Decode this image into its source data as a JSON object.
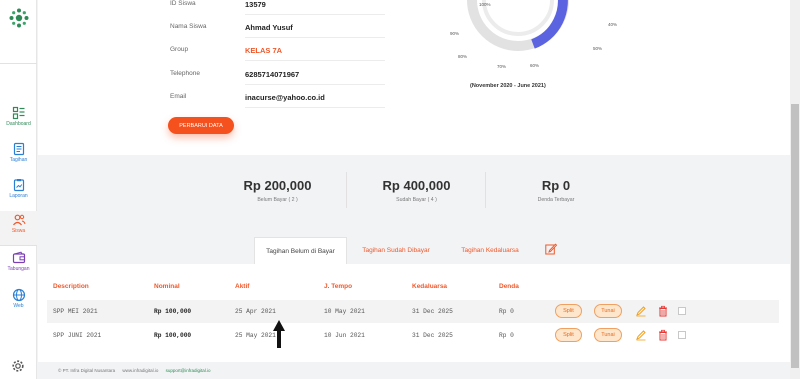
{
  "sidebar": {
    "logo_icon": "gear-cluster-logo",
    "items": [
      {
        "label": "Dashboard",
        "icon": "dashboard-icon"
      },
      {
        "label": "Tagihan",
        "icon": "bill-icon"
      },
      {
        "label": "Laporan",
        "icon": "report-icon"
      },
      {
        "label": "Siswa",
        "icon": "students-icon"
      },
      {
        "label": "Tabungan",
        "icon": "wallet-icon"
      },
      {
        "label": "Web",
        "icon": "globe-icon"
      }
    ],
    "active": "Siswa",
    "settings_icon": "settings-icon"
  },
  "student": {
    "id_label": "ID Siswa",
    "id_value": "13579",
    "name_label": "Nama Siswa",
    "name_value": "Ahmad Yusuf",
    "group_label": "Group",
    "group_value": "KELAS 7A",
    "phone_label": "Telephone",
    "phone_value": "6285714071967",
    "email_label": "Email",
    "email_value": "inacurse@yahoo.co.id",
    "update_button": "PERBARUI DATA"
  },
  "progress": {
    "labels": [
      "100%",
      "40%",
      "90%",
      "50%",
      "80%",
      "70%",
      "60%"
    ],
    "value_percent": 40,
    "period": "(November 2020 - June 2021)"
  },
  "summary": [
    {
      "value": "Rp 200,000",
      "label": "Belum Bayar ( 2 )"
    },
    {
      "value": "Rp 400,000",
      "label": "Sudah Bayar ( 4 )"
    },
    {
      "value": "Rp 0",
      "label": "Denda Terbayar"
    }
  ],
  "tabs": {
    "items": [
      "Tagihan Belum di Bayar",
      "Tagihan Sudah Dibayar",
      "Tagihan Kedaluarsa"
    ],
    "active": 0,
    "edit_icon": "edit-icon"
  },
  "table": {
    "headers": [
      "Description",
      "Nominal",
      "Aktif",
      "J. Tempo",
      "Kedaluarsa",
      "Denda"
    ],
    "rows": [
      {
        "description": "SPP MEI 2021",
        "nominal": "Rp 100,000",
        "aktif": "25 Apr 2021",
        "tempo": "10 May 2021",
        "kedaluarsa": "31 Dec 2025",
        "denda": "Rp 0"
      },
      {
        "description": "SPP JUNI 2021",
        "nominal": "Rp 100,000",
        "aktif": "25 May 2021",
        "tempo": "10 Jun 2021",
        "kedaluarsa": "31 Dec 2025",
        "denda": "Rp 0"
      }
    ],
    "split_label": "Split",
    "tunai_label": "Tunai"
  },
  "footer": {
    "company": "© PT. Infra Digital Nusantara",
    "site": "www.infradigital.io",
    "support": "support@infradigital.io"
  },
  "colors": {
    "accent": "#f4511e",
    "brand_green": "#2e8b57",
    "progress_blue": "#5b63e0"
  }
}
